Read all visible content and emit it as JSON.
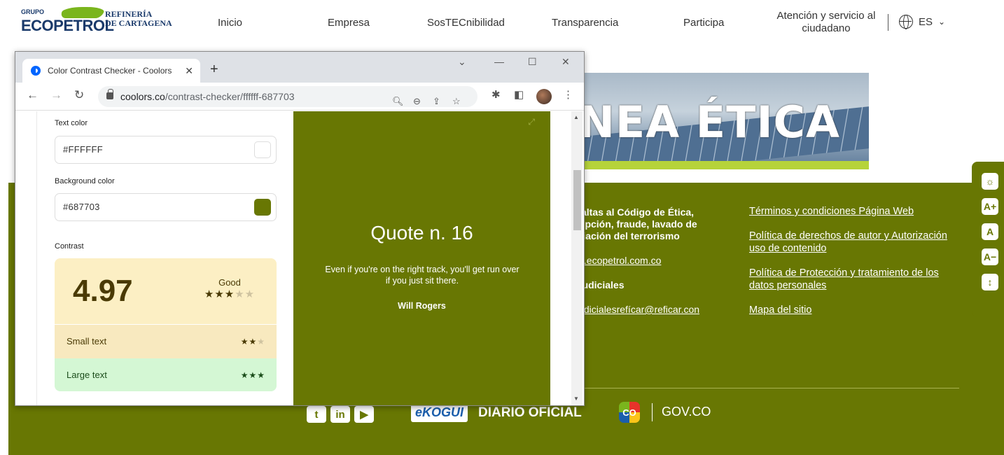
{
  "site": {
    "logo": {
      "grupo": "GRUPO",
      "ecopetrol": "ECOPETROL",
      "refineria": "REFINERÍA",
      "cartagena": "DE CARTAGENA"
    },
    "nav": [
      "Inicio",
      "Empresa",
      "SosTECnibilidad",
      "Transparencia",
      "Participa"
    ],
    "attention": "Atención y servicio al ciudadano",
    "language": "ES",
    "banner_title": "NEA ÉTICA",
    "footer": {
      "col1": {
        "line1": "r faltas al Código de Ética,",
        "line2": "rrupción, fraude, lavado de",
        "line3": "nciación del terrorismo",
        "email1": "ica.ecopetrol.com.co",
        "heading2": "s judiciales",
        "email2": "sjudicialesrefícar@reficar.con"
      },
      "col2_links": [
        "Términos y condiciones Página Web",
        "Política de derechos de autor y Autorización uso de contenido",
        "Política de Protección y tratamiento de los datos personales",
        "Mapa del sitio"
      ],
      "ekogui": "eKOGUI",
      "diario": "DIARIO OFICIAL",
      "co": "CO",
      "govco": "GOV.CO"
    },
    "a11y_buttons": [
      "☼",
      "A+",
      "A",
      "A−",
      "↕"
    ]
  },
  "browser": {
    "tab_title": "Color Contrast Checker - Coolors",
    "url_host": "coolors.co",
    "url_path": "/contrast-checker/ffffff-687703",
    "page": {
      "text_color_label": "Text color",
      "text_color_value": "#FFFFFF",
      "bg_color_label": "Background color",
      "bg_color_value": "#687703",
      "contrast_label": "Contrast",
      "ratio": "4.97",
      "rating": "Good",
      "small_text_label": "Small text",
      "large_text_label": "Large text",
      "quote_title": "Quote n. 16",
      "quote_text": "Even if you're on the right track, you'll get run over if you just sit there.",
      "quote_author": "Will Rogers"
    }
  },
  "colors": {
    "footer_green": "#687703",
    "text": "#FFFFFF"
  }
}
